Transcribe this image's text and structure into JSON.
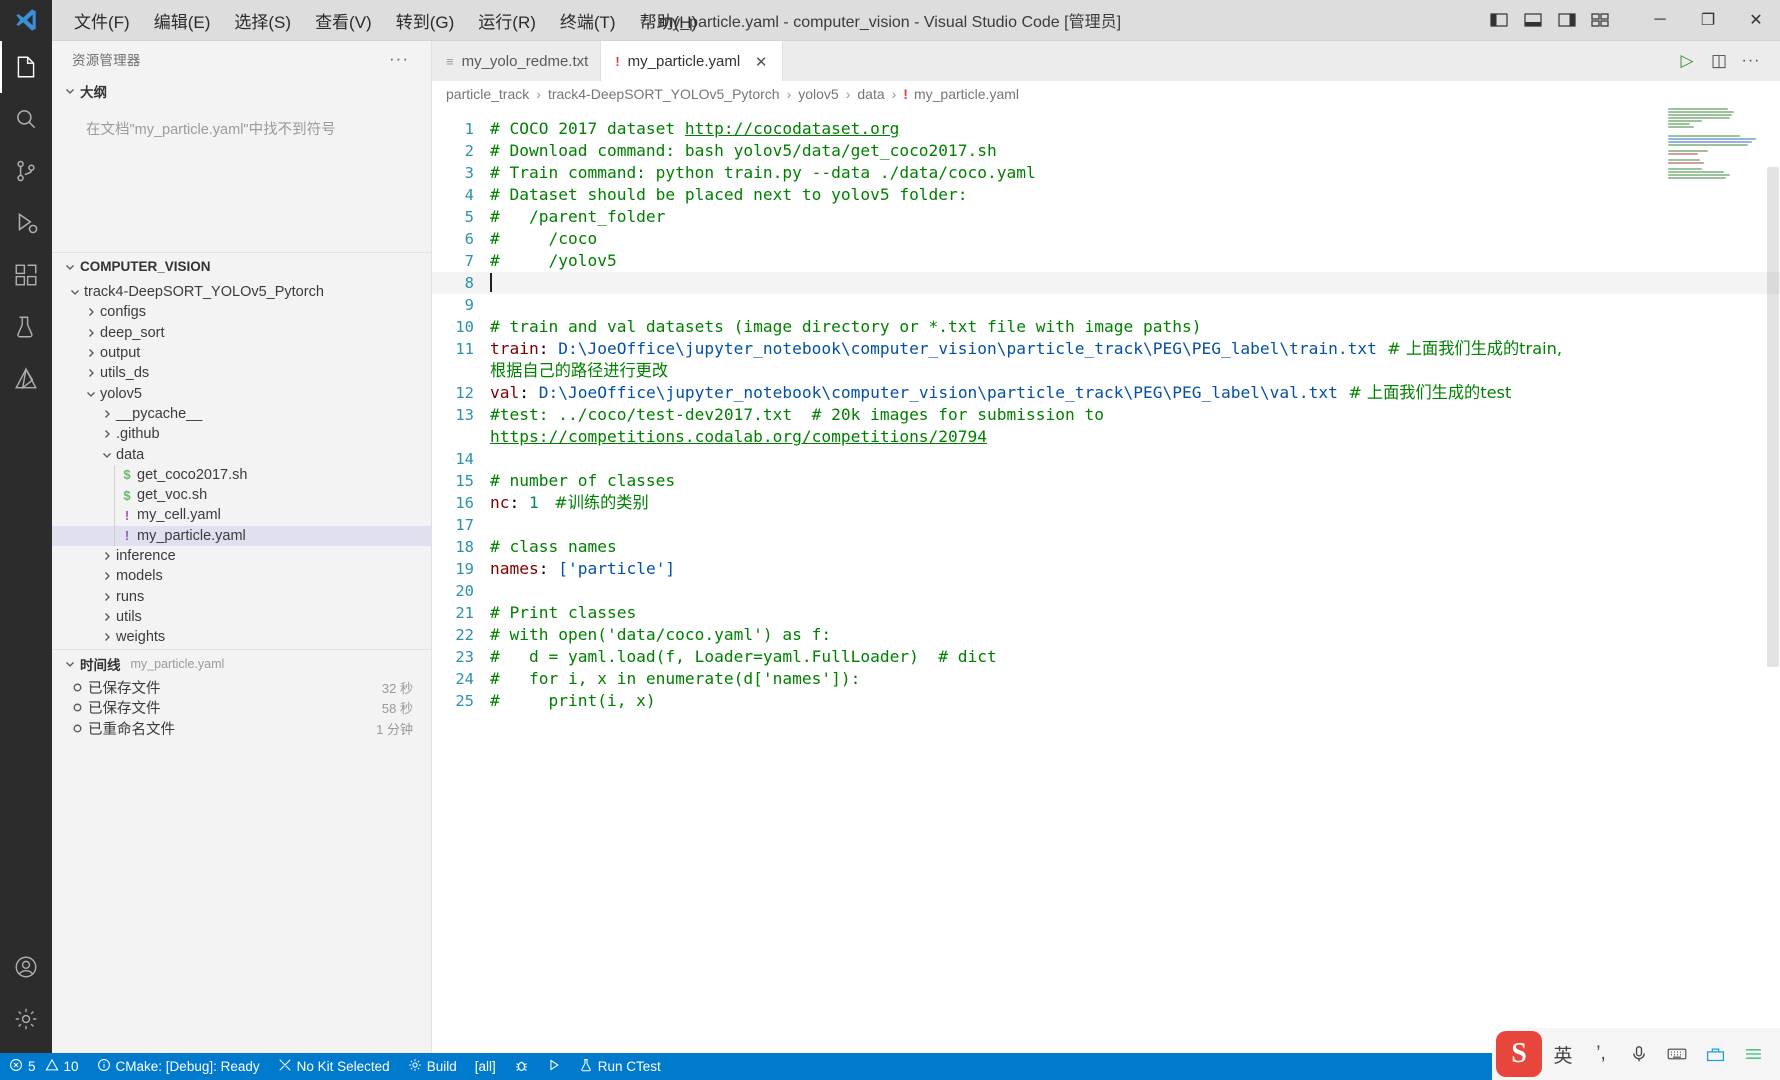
{
  "titlebar": {
    "window_title": "my_particle.yaml - computer_vision - Visual Studio Code [管理员]",
    "menu": [
      {
        "label": "文件(F)",
        "name": "menu-file"
      },
      {
        "label": "编辑(E)",
        "name": "menu-edit"
      },
      {
        "label": "选择(S)",
        "name": "menu-selection"
      },
      {
        "label": "查看(V)",
        "name": "menu-view"
      },
      {
        "label": "转到(G)",
        "name": "menu-go"
      },
      {
        "label": "运行(R)",
        "name": "menu-run"
      },
      {
        "label": "终端(T)",
        "name": "menu-terminal"
      },
      {
        "label": "帮助(H)",
        "name": "menu-help"
      }
    ],
    "minimize": "─",
    "maximize": "❐",
    "close": "✕"
  },
  "activitybar": {
    "items": [
      {
        "name": "explorer-icon",
        "title": "资源管理器"
      },
      {
        "name": "search-icon",
        "title": "搜索"
      },
      {
        "name": "source-control-icon",
        "title": "源代码管理"
      },
      {
        "name": "run-debug-icon",
        "title": "运行和调试"
      },
      {
        "name": "extensions-icon",
        "title": "扩展"
      },
      {
        "name": "testing-icon",
        "title": "测试"
      },
      {
        "name": "cmake-icon",
        "title": "CMake"
      }
    ],
    "bottom": [
      {
        "name": "accounts-icon",
        "title": "账户"
      },
      {
        "name": "manage-gear-icon",
        "title": "管理"
      }
    ]
  },
  "sidebar": {
    "title": "资源管理器",
    "more_actions": "···",
    "outline": {
      "label": "大纲",
      "empty_message": "在文档\"my_particle.yaml\"中找不到符号"
    },
    "explorer": {
      "root_label": "COMPUTER_VISION",
      "tree": [
        {
          "label": "track4-DeepSORT_YOLOv5_Pytorch",
          "depth": 1,
          "type": "folder",
          "expanded": true
        },
        {
          "label": "configs",
          "depth": 2,
          "type": "folder",
          "expanded": false
        },
        {
          "label": "deep_sort",
          "depth": 2,
          "type": "folder",
          "expanded": false
        },
        {
          "label": "output",
          "depth": 2,
          "type": "folder",
          "expanded": false
        },
        {
          "label": "utils_ds",
          "depth": 2,
          "type": "folder",
          "expanded": false
        },
        {
          "label": "yolov5",
          "depth": 2,
          "type": "folder",
          "expanded": true
        },
        {
          "label": "__pycache__",
          "depth": 3,
          "type": "folder",
          "expanded": false
        },
        {
          "label": ".github",
          "depth": 3,
          "type": "folder",
          "expanded": false
        },
        {
          "label": "data",
          "depth": 3,
          "type": "folder",
          "expanded": true
        },
        {
          "label": "get_coco2017.sh",
          "depth": 4,
          "type": "sh"
        },
        {
          "label": "get_voc.sh",
          "depth": 4,
          "type": "sh"
        },
        {
          "label": "my_cell.yaml",
          "depth": 4,
          "type": "yaml"
        },
        {
          "label": "my_particle.yaml",
          "depth": 4,
          "type": "yaml",
          "selected": true
        },
        {
          "label": "inference",
          "depth": 3,
          "type": "folder",
          "expanded": false
        },
        {
          "label": "models",
          "depth": 3,
          "type": "folder",
          "expanded": false
        },
        {
          "label": "runs",
          "depth": 3,
          "type": "folder",
          "expanded": false
        },
        {
          "label": "utils",
          "depth": 3,
          "type": "folder",
          "expanded": false
        },
        {
          "label": "weights",
          "depth": 3,
          "type": "folder",
          "expanded": false
        }
      ]
    },
    "timeline": {
      "label": "时间线",
      "sub_label": "my_particle.yaml",
      "rows": [
        {
          "label": "已保存文件",
          "time": "32 秒"
        },
        {
          "label": "已保存文件",
          "time": "58 秒"
        },
        {
          "label": "已重命名文件",
          "time": "1 分钟"
        }
      ]
    }
  },
  "editor": {
    "tabs": [
      {
        "label": "my_yolo_redme.txt",
        "icon": "text-file-icon",
        "active": false,
        "icon_char": "≡"
      },
      {
        "label": "my_particle.yaml",
        "icon": "yaml-file-icon",
        "active": true,
        "icon_char": "!",
        "close": "✕"
      }
    ],
    "tab_actions": [
      {
        "name": "run-button",
        "char": "▷"
      },
      {
        "name": "split-editor-icon",
        "char": "◫"
      },
      {
        "name": "more-actions-icon",
        "char": "···"
      }
    ],
    "breadcrumbs": [
      "particle_track",
      "track4-DeepSORT_YOLOv5_Pytorch",
      "yolov5",
      "data"
    ],
    "breadcrumb_file": "my_particle.yaml",
    "breadcrumb_sep": "›",
    "lines": [
      {
        "n": "1",
        "parts": [
          {
            "t": "# COCO 2017 dataset ",
            "c": "cmt"
          },
          {
            "t": "http://cocodataset.org",
            "c": "lnk-g"
          }
        ]
      },
      {
        "n": "2",
        "parts": [
          {
            "t": "# Download command: bash yolov5/data/get_coco2017.sh",
            "c": "cmt"
          }
        ]
      },
      {
        "n": "3",
        "parts": [
          {
            "t": "# Train command: python train.py --data ./data/coco.yaml",
            "c": "cmt"
          }
        ]
      },
      {
        "n": "4",
        "parts": [
          {
            "t": "# Dataset should be placed next to yolov5 folder:",
            "c": "cmt"
          }
        ]
      },
      {
        "n": "5",
        "parts": [
          {
            "t": "#   /parent_folder",
            "c": "cmt"
          }
        ]
      },
      {
        "n": "6",
        "parts": [
          {
            "t": "#     /coco",
            "c": "cmt"
          }
        ]
      },
      {
        "n": "7",
        "parts": [
          {
            "t": "#     /yolov5",
            "c": "cmt"
          }
        ]
      },
      {
        "n": "8",
        "cursor": true,
        "parts": []
      },
      {
        "n": "9",
        "parts": []
      },
      {
        "n": "10",
        "parts": [
          {
            "t": "# train and val datasets (image directory or *.txt file with image paths)",
            "c": "cmt"
          }
        ]
      },
      {
        "n": "11",
        "parts": [
          {
            "t": "train",
            "c": "key"
          },
          {
            "t": ": ",
            "c": ""
          },
          {
            "t": "D:\\JoeOffice\\jupyter_notebook\\computer_vision\\particle_track\\PEG\\PEG_label\\train.txt",
            "c": "str"
          },
          {
            "t": "  # 上面我们生成的train, 根据自己的路径进行更改",
            "c": "cmt cjk"
          }
        ]
      },
      {
        "n": "12",
        "parts": [
          {
            "t": "val",
            "c": "key"
          },
          {
            "t": ": ",
            "c": ""
          },
          {
            "t": "D:\\JoeOffice\\jupyter_notebook\\computer_vision\\particle_track\\PEG\\PEG_label\\val.txt",
            "c": "str"
          },
          {
            "t": "  # 上面我们生成的test",
            "c": "cmt cjk"
          }
        ]
      },
      {
        "n": "13",
        "parts": [
          {
            "t": "#test: ../coco/test-dev2017.txt  # 20k images for submission to ",
            "c": "cmt"
          },
          {
            "t": "https://competitions.codalab.org/competitions/20794",
            "c": "lnk-g"
          }
        ]
      },
      {
        "n": "14",
        "parts": []
      },
      {
        "n": "15",
        "parts": [
          {
            "t": "# number of classes",
            "c": "cmt"
          }
        ]
      },
      {
        "n": "16",
        "parts": [
          {
            "t": "nc",
            "c": "key"
          },
          {
            "t": ": ",
            "c": ""
          },
          {
            "t": "1",
            "c": "num"
          },
          {
            "t": "   #训练的类别",
            "c": "cmt cjk"
          }
        ]
      },
      {
        "n": "17",
        "parts": []
      },
      {
        "n": "18",
        "parts": [
          {
            "t": "# class names",
            "c": "cmt"
          }
        ]
      },
      {
        "n": "19",
        "parts": [
          {
            "t": "names",
            "c": "key"
          },
          {
            "t": ": ",
            "c": ""
          },
          {
            "t": "['particle']",
            "c": "str"
          }
        ]
      },
      {
        "n": "20",
        "parts": []
      },
      {
        "n": "21",
        "parts": [
          {
            "t": "# Print classes",
            "c": "cmt"
          }
        ]
      },
      {
        "n": "22",
        "parts": [
          {
            "t": "# with open('data/coco.yaml') as f:",
            "c": "cmt"
          }
        ]
      },
      {
        "n": "23",
        "parts": [
          {
            "t": "#   d = yaml.load(f, Loader=yaml.FullLoader)  # dict",
            "c": "cmt"
          }
        ]
      },
      {
        "n": "24",
        "parts": [
          {
            "t": "#   for i, x in enumerate(d['names']):",
            "c": "cmt"
          }
        ]
      },
      {
        "n": "25",
        "parts": [
          {
            "t": "#     print(i, x)",
            "c": "cmt"
          }
        ]
      }
    ]
  },
  "statusbar": {
    "background": "#007acc",
    "left_items": [
      {
        "name": "problems-status",
        "icon": "error-icon",
        "label": "5",
        "icon2": "warning-icon",
        "label2": "10"
      },
      {
        "name": "cmake-status",
        "icon": "info-icon",
        "label": "CMake: [Debug]: Ready"
      },
      {
        "name": "kit-status",
        "icon": "tools-icon",
        "label": "No Kit Selected"
      },
      {
        "name": "build-status",
        "icon": "gear-icon",
        "label": "Build"
      },
      {
        "name": "target-status",
        "label": "[all]"
      },
      {
        "name": "debug-status",
        "icon": "bug-icon",
        "label": ""
      },
      {
        "name": "launch-status",
        "icon": "play-icon",
        "label": ""
      },
      {
        "name": "ctest-status",
        "icon": "flask-icon",
        "label": "Run CTest"
      }
    ]
  },
  "ime_tray": {
    "logo": "S",
    "buttons": [
      {
        "name": "ime-language-toggle",
        "char": "英"
      },
      {
        "name": "ime-punctuation-toggle",
        "char": "’,"
      },
      {
        "name": "ime-voice-input-icon",
        "char": "⬤"
      },
      {
        "name": "ime-keyboard-icon",
        "char": "⌨"
      },
      {
        "name": "ime-toolbox-icon",
        "char": "⬟"
      },
      {
        "name": "ime-settings-icon",
        "char": "☰"
      }
    ]
  }
}
